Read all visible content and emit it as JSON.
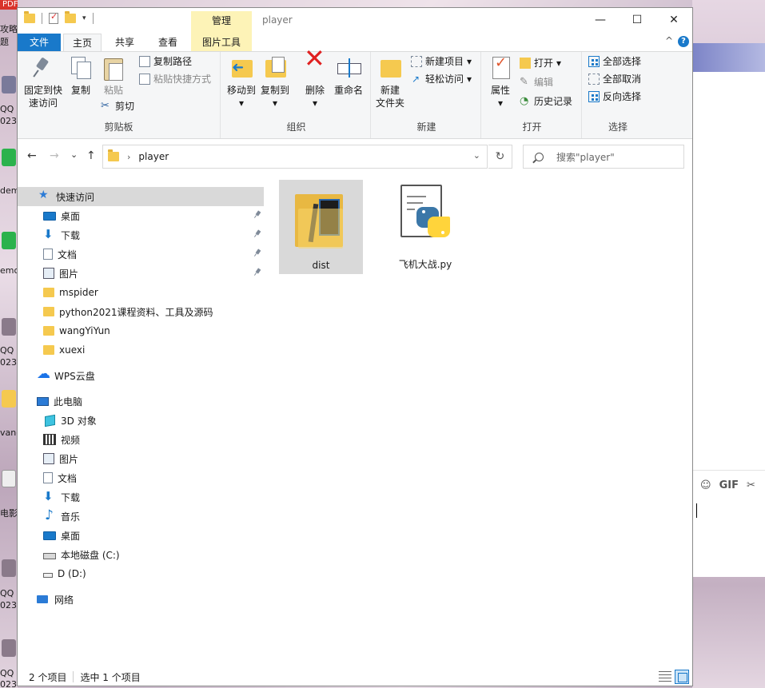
{
  "desktop": {
    "pdf_tag": "PDF",
    "left_labels": [
      "攻略",
      "题",
      "QQ",
      "023",
      "dem",
      "emo",
      "QQ",
      "023",
      "vang",
      "电影",
      "QQ",
      "023",
      "QQ",
      "023"
    ]
  },
  "window": {
    "title": "player",
    "manage_tab": "管理",
    "controls": {
      "minimize": "—",
      "maximize": "☐",
      "close": "✕"
    }
  },
  "ribbon_tabs": {
    "file": "文件",
    "home": "主页",
    "share": "共享",
    "view": "查看",
    "picture_tools": "图片工具",
    "collapse": "^",
    "help": "?"
  },
  "ribbon": {
    "clipboard": {
      "label": "剪贴板",
      "pin_line1": "固定到快",
      "pin_line2": "速访问",
      "copy": "复制",
      "paste": "粘贴",
      "copy_path": "复制路径",
      "paste_shortcut": "粘贴快捷方式",
      "cut": "剪切"
    },
    "organize": {
      "label": "组织",
      "move_to": "移动到",
      "copy_to": "复制到",
      "delete": "删除",
      "rename": "重命名"
    },
    "new": {
      "label": "新建",
      "new_folder_line1": "新建",
      "new_folder_line2": "文件夹",
      "new_item": "新建项目",
      "easy_access": "轻松访问"
    },
    "open": {
      "label": "打开",
      "properties": "属性",
      "open": "打开",
      "edit": "编辑",
      "history": "历史记录"
    },
    "select": {
      "label": "选择",
      "select_all": "全部选择",
      "select_none": "全部取消",
      "invert": "反向选择"
    }
  },
  "navbar": {
    "back": "←",
    "forward": "→",
    "recent": "⌄",
    "up": "↑",
    "breadcrumb_sep": "›",
    "path": "player",
    "dropdown": "⌄",
    "refresh": "↻",
    "search_placeholder": "搜索\"player\""
  },
  "nav_pane": {
    "quick_access": "快速访问",
    "quick_items": [
      {
        "label": "桌面"
      },
      {
        "label": "下载"
      },
      {
        "label": "文档"
      },
      {
        "label": "图片"
      },
      {
        "label": "mspider"
      },
      {
        "label": "python2021课程资料、工具及源码"
      },
      {
        "label": "wangYiYun"
      },
      {
        "label": "xuexi"
      }
    ],
    "wps": "WPS云盘",
    "this_pc": "此电脑",
    "pc_items": [
      {
        "label": "3D 对象"
      },
      {
        "label": "视频"
      },
      {
        "label": "图片"
      },
      {
        "label": "文档"
      },
      {
        "label": "下载"
      },
      {
        "label": "音乐"
      },
      {
        "label": "桌面"
      },
      {
        "label": "本地磁盘 (C:)"
      },
      {
        "label": "D (D:)"
      }
    ],
    "network": "网络"
  },
  "files": [
    {
      "name": "dist",
      "type": "folder",
      "selected": true
    },
    {
      "name": "飞机大战.py",
      "type": "python-file",
      "selected": false
    }
  ],
  "status": {
    "count": "2 个项目",
    "selection": "选中 1 个项目"
  },
  "qq_panel": {
    "gif": "GIF"
  },
  "colors": {
    "accent": "#1979ca",
    "manage_tab_bg": "#fdf3b7",
    "selection_bg": "#d9d9d9",
    "ribbon_bg": "#f5f6f7"
  }
}
